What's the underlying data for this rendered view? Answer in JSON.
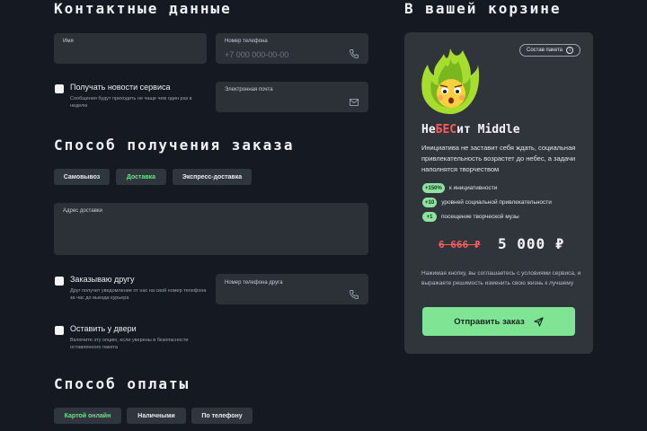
{
  "contact": {
    "title": "Контактные данные",
    "name_label": "Имя",
    "phone_label": "Номер телефона",
    "phone_placeholder": "+7 000 000-00-00",
    "email_label": "Электронная почта",
    "news": {
      "title": "Получать новости сервиса",
      "subtitle": "Сообщения будут приходить не чаще чем один раз в неделю"
    }
  },
  "delivery": {
    "title": "Способ получения заказа",
    "options": [
      "Самовывоз",
      "Доставка",
      "Экспресс-доставка"
    ],
    "selected": "Доставка",
    "address_label": "Адрес доставки",
    "gift": {
      "title": "Заказываю другу",
      "subtitle": "Друг получит уведомление от нас на свой номер телефона за час до выезда курьера"
    },
    "friend_phone_label": "Номер телефона друга",
    "door": {
      "title": "Оставить у двери",
      "subtitle": "Включите эту опцию, если уверены в безопасности оставленного пакета"
    }
  },
  "payment": {
    "title": "Способ оплаты",
    "options": [
      "Картой онлайн",
      "Наличными",
      "По телефону"
    ],
    "selected": "Картой онлайн"
  },
  "cart": {
    "title": "В вашей корзине",
    "package_button": "Состав пакета",
    "product": {
      "name_start": "Не",
      "name_highlight": "БЕС",
      "name_end": "ит Middle",
      "description": "Инициатива не заставит себя ждать, социальная привлекательность возрастет до небес, а задачи наполнятся творчеством",
      "perks": [
        {
          "badge": "+150%",
          "text": "к инициативности"
        },
        {
          "badge": "+10",
          "text": "уровней социальной привлекательности"
        },
        {
          "badge": "+1",
          "text": "посещение творческой музы"
        }
      ],
      "old_price": "6 666 ₽",
      "price": "5 000 ₽"
    },
    "note": "Нажимая кнопку, вы соглашаетесь с условиями сервиса, и выражаете решимость изменить свою жизнь к лучшему",
    "submit_label": "Отправить заказ"
  },
  "colors": {
    "background": "#151a22",
    "field": "#2c3138",
    "accent": "#7fe595",
    "accent_text": "#6fe08a",
    "price_old": "#ff5a5a"
  },
  "icons": [
    "phone-icon",
    "mail-icon",
    "info-icon",
    "send-icon",
    "fire-emoji-icon"
  ]
}
